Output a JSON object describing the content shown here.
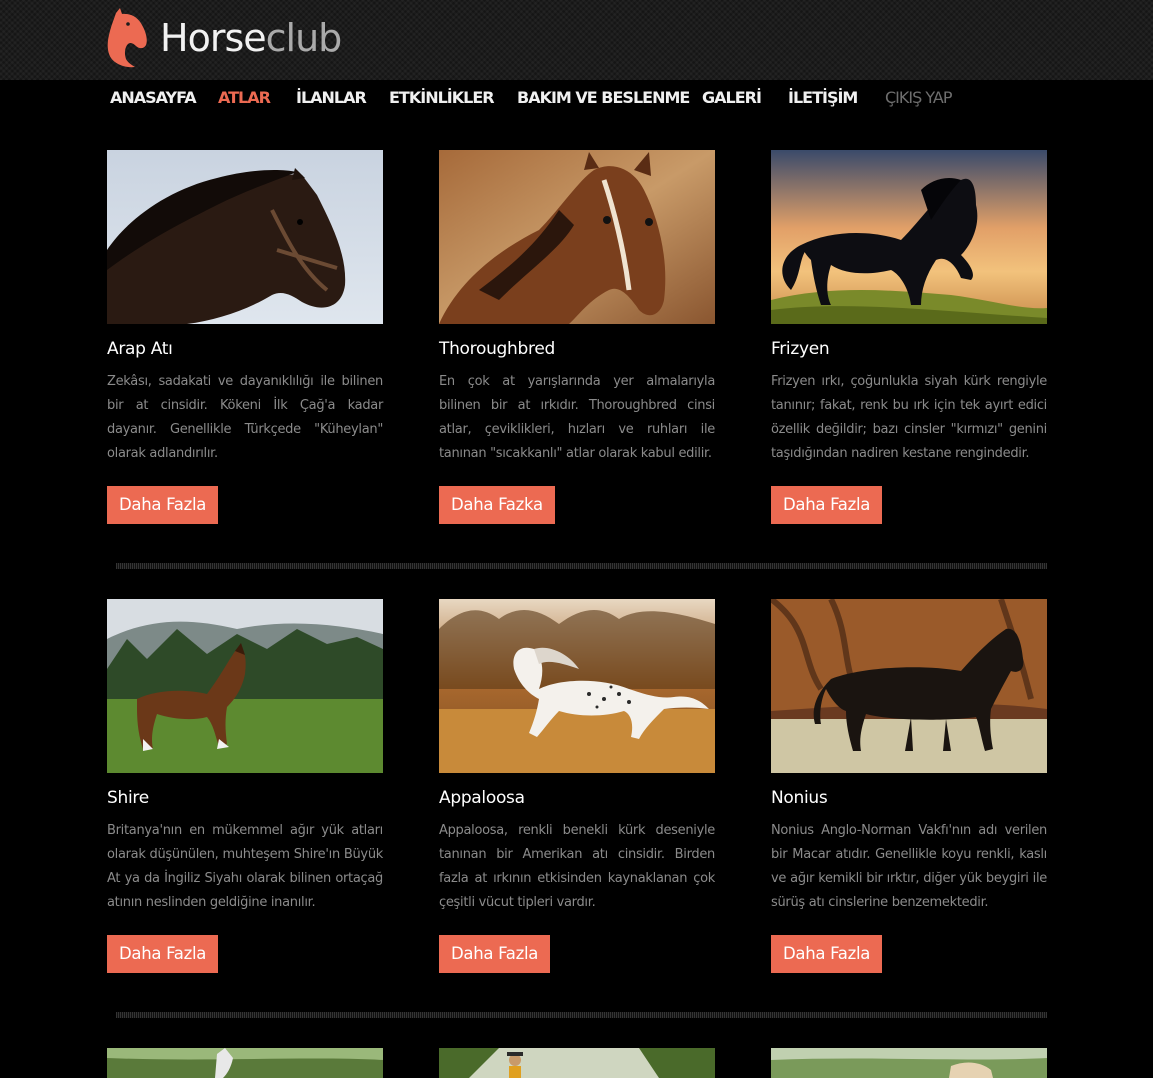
{
  "brand": {
    "part1": "Horse",
    "part2": "club",
    "logo_icon": "horse-head-icon",
    "accent": "#ec6a52"
  },
  "nav": [
    {
      "label": "ANASAYFA",
      "state": "normal"
    },
    {
      "label": "ATLAR",
      "state": "active"
    },
    {
      "label": "İLANLAR",
      "state": "normal"
    },
    {
      "label": "ETKİNLİKLER",
      "state": "normal"
    },
    {
      "label": "BAKIM VE BESLENME",
      "state": "normal"
    },
    {
      "label": "GALERİ",
      "state": "normal"
    },
    {
      "label": "İLETİŞİM",
      "state": "normal"
    },
    {
      "label": "ÇIKIŞ YAP",
      "state": "muted"
    }
  ],
  "cards": [
    {
      "title": "Arap Atı",
      "description": "Zekâsı, sadakati ve dayanıklılığı ile bilinen bir at cinsidir. Kökeni İlk Çağ'a kadar dayanır. Genellikle Türkçede \"Küheylan\" olarak adlandırılır.",
      "button": "Daha Fazla"
    },
    {
      "title": "Thoroughbred",
      "description": "En çok at yarışlarında yer almalarıyla bilinen bir at ırkıdır. Thoroughbred cinsi atlar, çeviklikleri, hızları ve ruhları ile tanınan \"sıcakkanlı\" atlar olarak kabul edilir.",
      "button": "Daha Fazka"
    },
    {
      "title": "Frizyen",
      "description": "Frizyen ırkı, çoğunlukla siyah kürk rengiyle tanınır; fakat, renk bu ırk için tek ayırt edici özellik değildir; bazı cinsler \"kırmızı\" genini taşıdığından nadiren kestane rengindedir.",
      "button": "Daha Fazla"
    },
    {
      "title": "Shire",
      "description": "Britanya'nın en mükemmel ağır yük atları olarak düşünülen, muhteşem Shire'ın Büyük At ya da İngiliz Siyahı olarak bilinen ortaçağ atının neslinden geldiğine inanılır.",
      "button": "Daha Fazla"
    },
    {
      "title": "Appaloosa",
      "description": "Appaloosa, renkli benekli kürk deseniyle tanınan bir Amerikan atı cinsidir. Birden fazla at ırkının etkisinden kaynaklanan çok çeşitli vücut tipleri vardır.",
      "button": "Daha Fazla"
    },
    {
      "title": "Nonius",
      "description": "Nonius Anglo-Norman Vakfı'nın adı verilen bir Macar atıdır. Genellikle koyu renkli, kaslı ve ağır kemikli bir ırktır, diğer yük beygiri ile sürüş atı cinslerine benzemektedir.",
      "button": "Daha Fazla"
    }
  ]
}
